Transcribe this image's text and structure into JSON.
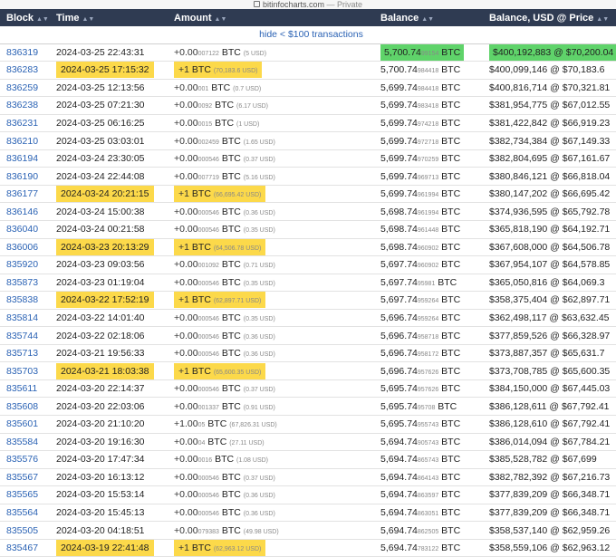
{
  "browser": {
    "url": "bitinfocharts.com",
    "mode": "Private"
  },
  "table": {
    "headers": {
      "block": "Block",
      "time": "Time",
      "amount": "Amount",
      "balance": "Balance",
      "balance_usd": "Balance, USD @ Price"
    },
    "hide_link": "hide < $100 transactions",
    "highlight_colors": {
      "yellow": "#fcd94a",
      "green": "#5fd36a"
    },
    "rows": [
      {
        "block": "836319",
        "time": "2024-03-25 22:43:31",
        "amt_main": "+0.00",
        "amt_small": "007122",
        "amt_unit": "BTC",
        "amt_usd": "(5 USD)",
        "bal_main": "5,700.74",
        "bal_small": "99154",
        "bal_unit": "BTC",
        "usd": "$400,192,883 @ $70,200.04",
        "hl": "green"
      },
      {
        "block": "836283",
        "time": "2024-03-25 17:15:32",
        "amt_main": "+1",
        "amt_small": "",
        "amt_unit": "BTC",
        "amt_usd": "(70,183.6 USD)",
        "bal_main": "5,700.74",
        "bal_small": "984418",
        "bal_unit": "BTC",
        "usd": "$400,099,146 @ $70,183.6",
        "hl": "yellow"
      },
      {
        "block": "836259",
        "time": "2024-03-25 12:13:56",
        "amt_main": "+0.00",
        "amt_small": "001",
        "amt_unit": "BTC",
        "amt_usd": "(0.7 USD)",
        "bal_main": "5,699.74",
        "bal_small": "984418",
        "bal_unit": "BTC",
        "usd": "$400,816,714 @ $70,321.81",
        "hl": ""
      },
      {
        "block": "836238",
        "time": "2024-03-25 07:21:30",
        "amt_main": "+0.00",
        "amt_small": "0092",
        "amt_unit": "BTC",
        "amt_usd": "(6.17 USD)",
        "bal_main": "5,699.74",
        "bal_small": "983418",
        "bal_unit": "BTC",
        "usd": "$381,954,775 @ $67,012.55",
        "hl": ""
      },
      {
        "block": "836231",
        "time": "2024-03-25 06:16:25",
        "amt_main": "+0.00",
        "amt_small": "0015",
        "amt_unit": "BTC",
        "amt_usd": "(1 USD)",
        "bal_main": "5,699.74",
        "bal_small": "974218",
        "bal_unit": "BTC",
        "usd": "$381,422,842 @ $66,919.23",
        "hl": ""
      },
      {
        "block": "836210",
        "time": "2024-03-25 03:03:01",
        "amt_main": "+0.00",
        "amt_small": "002459",
        "amt_unit": "BTC",
        "amt_usd": "(1.65 USD)",
        "bal_main": "5,699.74",
        "bal_small": "972718",
        "bal_unit": "BTC",
        "usd": "$382,734,384 @ $67,149.33",
        "hl": ""
      },
      {
        "block": "836194",
        "time": "2024-03-24 23:30:05",
        "amt_main": "+0.00",
        "amt_small": "000546",
        "amt_unit": "BTC",
        "amt_usd": "(0.37 USD)",
        "bal_main": "5,699.74",
        "bal_small": "970259",
        "bal_unit": "BTC",
        "usd": "$382,804,695 @ $67,161.67",
        "hl": ""
      },
      {
        "block": "836190",
        "time": "2024-03-24 22:44:08",
        "amt_main": "+0.00",
        "amt_small": "007719",
        "amt_unit": "BTC",
        "amt_usd": "(5.16 USD)",
        "bal_main": "5,699.74",
        "bal_small": "969713",
        "bal_unit": "BTC",
        "usd": "$380,846,121 @ $66,818.04",
        "hl": ""
      },
      {
        "block": "836177",
        "time": "2024-03-24 20:21:15",
        "amt_main": "+1",
        "amt_small": "",
        "amt_unit": "BTC",
        "amt_usd": "(66,695.42 USD)",
        "bal_main": "5,699.74",
        "bal_small": "961994",
        "bal_unit": "BTC",
        "usd": "$380,147,202 @ $66,695.42",
        "hl": "yellow"
      },
      {
        "block": "836146",
        "time": "2024-03-24 15:00:38",
        "amt_main": "+0.00",
        "amt_small": "000546",
        "amt_unit": "BTC",
        "amt_usd": "(0.36 USD)",
        "bal_main": "5,698.74",
        "bal_small": "961994",
        "bal_unit": "BTC",
        "usd": "$374,936,595 @ $65,792.78",
        "hl": ""
      },
      {
        "block": "836040",
        "time": "2024-03-24 00:21:58",
        "amt_main": "+0.00",
        "amt_small": "000546",
        "amt_unit": "BTC",
        "amt_usd": "(0.35 USD)",
        "bal_main": "5,698.74",
        "bal_small": "961448",
        "bal_unit": "BTC",
        "usd": "$365,818,190 @ $64,192.71",
        "hl": ""
      },
      {
        "block": "836006",
        "time": "2024-03-23 20:13:29",
        "amt_main": "+1",
        "amt_small": "",
        "amt_unit": "BTC",
        "amt_usd": "(64,506.78 USD)",
        "bal_main": "5,698.74",
        "bal_small": "960902",
        "bal_unit": "BTC",
        "usd": "$367,608,000 @ $64,506.78",
        "hl": "yellow"
      },
      {
        "block": "835920",
        "time": "2024-03-23 09:03:56",
        "amt_main": "+0.00",
        "amt_small": "001092",
        "amt_unit": "BTC",
        "amt_usd": "(0.71 USD)",
        "bal_main": "5,697.74",
        "bal_small": "960902",
        "bal_unit": "BTC",
        "usd": "$367,954,107 @ $64,578.85",
        "hl": ""
      },
      {
        "block": "835873",
        "time": "2024-03-23 01:19:04",
        "amt_main": "+0.00",
        "amt_small": "000546",
        "amt_unit": "BTC",
        "amt_usd": "(0.35 USD)",
        "bal_main": "5,697.74",
        "bal_small": "95981",
        "bal_unit": "BTC",
        "usd": "$365,050,816 @ $64,069.3",
        "hl": ""
      },
      {
        "block": "835838",
        "time": "2024-03-22 17:52:19",
        "amt_main": "+1",
        "amt_small": "",
        "amt_unit": "BTC",
        "amt_usd": "(62,897.71 USD)",
        "bal_main": "5,697.74",
        "bal_small": "959264",
        "bal_unit": "BTC",
        "usd": "$358,375,404 @ $62,897.71",
        "hl": "yellow"
      },
      {
        "block": "835814",
        "time": "2024-03-22 14:01:40",
        "amt_main": "+0.00",
        "amt_small": "000546",
        "amt_unit": "BTC",
        "amt_usd": "(0.35 USD)",
        "bal_main": "5,696.74",
        "bal_small": "959264",
        "bal_unit": "BTC",
        "usd": "$362,498,117 @ $63,632.45",
        "hl": ""
      },
      {
        "block": "835744",
        "time": "2024-03-22 02:18:06",
        "amt_main": "+0.00",
        "amt_small": "000546",
        "amt_unit": "BTC",
        "amt_usd": "(0.36 USD)",
        "bal_main": "5,696.74",
        "bal_small": "958718",
        "bal_unit": "BTC",
        "usd": "$377,859,526 @ $66,328.97",
        "hl": ""
      },
      {
        "block": "835713",
        "time": "2024-03-21 19:56:33",
        "amt_main": "+0.00",
        "amt_small": "000546",
        "amt_unit": "BTC",
        "amt_usd": "(0.36 USD)",
        "bal_main": "5,696.74",
        "bal_small": "958172",
        "bal_unit": "BTC",
        "usd": "$373,887,357 @ $65,631.7",
        "hl": ""
      },
      {
        "block": "835703",
        "time": "2024-03-21 18:03:38",
        "amt_main": "+1",
        "amt_small": "",
        "amt_unit": "BTC",
        "amt_usd": "(65,600.35 USD)",
        "bal_main": "5,696.74",
        "bal_small": "957626",
        "bal_unit": "BTC",
        "usd": "$373,708,785 @ $65,600.35",
        "hl": "yellow"
      },
      {
        "block": "835611",
        "time": "2024-03-20 22:14:37",
        "amt_main": "+0.00",
        "amt_small": "000546",
        "amt_unit": "BTC",
        "amt_usd": "(0.37 USD)",
        "bal_main": "5,695.74",
        "bal_small": "957626",
        "bal_unit": "BTC",
        "usd": "$384,150,000 @ $67,445.03",
        "hl": ""
      },
      {
        "block": "835608",
        "time": "2024-03-20 22:03:06",
        "amt_main": "+0.00",
        "amt_small": "001337",
        "amt_unit": "BTC",
        "amt_usd": "(0.91 USD)",
        "bal_main": "5,695.74",
        "bal_small": "95708",
        "bal_unit": "BTC",
        "usd": "$386,128,611 @ $67,792.41",
        "hl": ""
      },
      {
        "block": "835601",
        "time": "2024-03-20 21:10:20",
        "amt_main": "+1.00",
        "amt_small": "05",
        "amt_unit": "BTC",
        "amt_usd": "(67,826.31 USD)",
        "bal_main": "5,695.74",
        "bal_small": "955743",
        "bal_unit": "BTC",
        "usd": "$386,128,610 @ $67,792.41",
        "hl": ""
      },
      {
        "block": "835584",
        "time": "2024-03-20 19:16:30",
        "amt_main": "+0.00",
        "amt_small": "04",
        "amt_unit": "BTC",
        "amt_usd": "(27.11 USD)",
        "bal_main": "5,694.74",
        "bal_small": "905743",
        "bal_unit": "BTC",
        "usd": "$386,014,094 @ $67,784.21",
        "hl": ""
      },
      {
        "block": "835576",
        "time": "2024-03-20 17:47:34",
        "amt_main": "+0.00",
        "amt_small": "0016",
        "amt_unit": "BTC",
        "amt_usd": "(1.08 USD)",
        "bal_main": "5,694.74",
        "bal_small": "865743",
        "bal_unit": "BTC",
        "usd": "$385,528,782 @ $67,699",
        "hl": ""
      },
      {
        "block": "835567",
        "time": "2024-03-20 16:13:12",
        "amt_main": "+0.00",
        "amt_small": "000546",
        "amt_unit": "BTC",
        "amt_usd": "(0.37 USD)",
        "bal_main": "5,694.74",
        "bal_small": "864143",
        "bal_unit": "BTC",
        "usd": "$382,782,392 @ $67,216.73",
        "hl": ""
      },
      {
        "block": "835565",
        "time": "2024-03-20 15:53:14",
        "amt_main": "+0.00",
        "amt_small": "000546",
        "amt_unit": "BTC",
        "amt_usd": "(0.36 USD)",
        "bal_main": "5,694.74",
        "bal_small": "863597",
        "bal_unit": "BTC",
        "usd": "$377,839,209 @ $66,348.71",
        "hl": ""
      },
      {
        "block": "835564",
        "time": "2024-03-20 15:45:13",
        "amt_main": "+0.00",
        "amt_small": "000546",
        "amt_unit": "BTC",
        "amt_usd": "(0.36 USD)",
        "bal_main": "5,694.74",
        "bal_small": "863051",
        "bal_unit": "BTC",
        "usd": "$377,839,209 @ $66,348.71",
        "hl": ""
      },
      {
        "block": "835505",
        "time": "2024-03-20 04:18:51",
        "amt_main": "+0.00",
        "amt_small": "079383",
        "amt_unit": "BTC",
        "amt_usd": "(49.98 USD)",
        "bal_main": "5,694.74",
        "bal_small": "862505",
        "bal_unit": "BTC",
        "usd": "$358,537,140 @ $62,959.26",
        "hl": ""
      },
      {
        "block": "835467",
        "time": "2024-03-19 22:41:48",
        "amt_main": "+1",
        "amt_small": "",
        "amt_unit": "BTC",
        "amt_usd": "(62,963.12 USD)",
        "bal_main": "5,694.74",
        "bal_small": "783122",
        "bal_unit": "BTC",
        "usd": "$358,559,106 @ $62,963.12",
        "hl": "yellow"
      }
    ]
  }
}
